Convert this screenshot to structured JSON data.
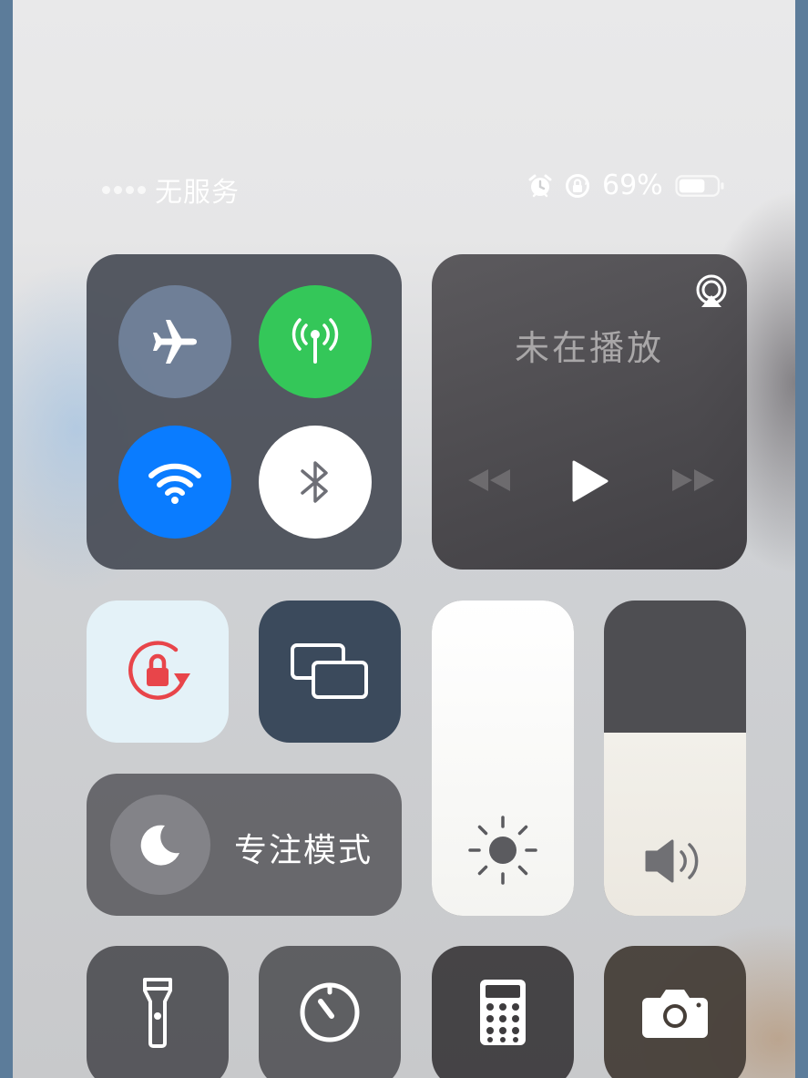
{
  "status_bar": {
    "carrier": "无服务",
    "battery_percent": "69%",
    "battery_level": 0.69,
    "icons": [
      "signal-dots-icon",
      "alarm-icon",
      "orientation-lock-icon",
      "battery-icon"
    ]
  },
  "connectivity": {
    "airplane": {
      "icon": "airplane-icon",
      "state": "off"
    },
    "cellular": {
      "icon": "antenna-icon",
      "state": "on",
      "color": "#34c759"
    },
    "wifi": {
      "icon": "wifi-icon",
      "state": "on",
      "color": "#0a7cff"
    },
    "bluetooth": {
      "icon": "bluetooth-icon",
      "state": "on",
      "color": "#ffffff"
    }
  },
  "now_playing": {
    "title": "未在播放",
    "icons": [
      "airplay-icon",
      "rewind-icon",
      "play-icon",
      "fast-forward-icon"
    ]
  },
  "orientation_lock": {
    "icon": "rotation-lock-icon",
    "state": "on",
    "color": "#e8454a"
  },
  "screen_mirroring": {
    "icon": "screen-mirroring-icon"
  },
  "focus": {
    "label": "专注模式",
    "icon": "moon-icon"
  },
  "brightness": {
    "level": 1.0,
    "icon": "sun-icon"
  },
  "volume": {
    "level": 0.58,
    "icon": "speaker-icon"
  },
  "shortcuts": [
    {
      "icon": "flashlight-icon"
    },
    {
      "icon": "timer-icon"
    },
    {
      "icon": "calculator-icon"
    },
    {
      "icon": "camera-icon"
    }
  ]
}
